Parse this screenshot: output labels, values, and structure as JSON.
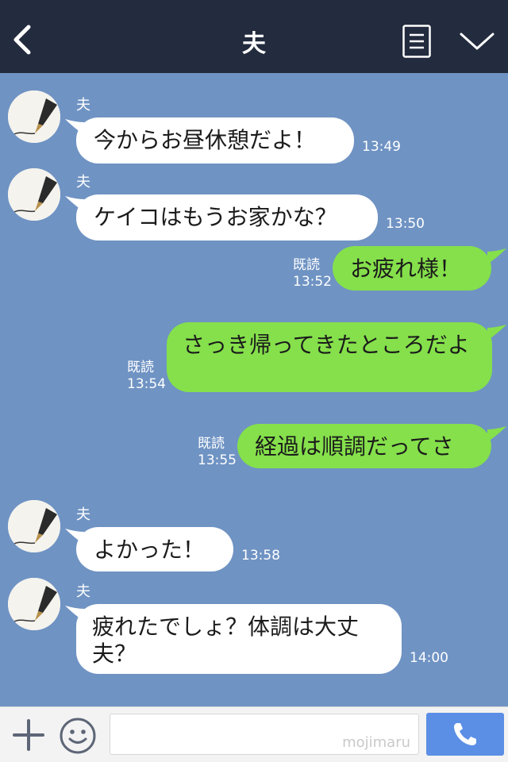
{
  "header": {
    "title": "夫"
  },
  "messages": [
    {
      "sender": "夫",
      "text": "今からお昼休憩だよ！",
      "time": "13:49"
    },
    {
      "sender": "夫",
      "text": "ケイコはもうお家かな？",
      "time": "13:50"
    },
    {
      "read": "既読",
      "text": "お疲れ様！",
      "time": "13:52"
    },
    {
      "read": "既読",
      "text": "さっき帰ってきたところだよ",
      "time": "13:54"
    },
    {
      "read": "既読",
      "text": "経過は順調だってさ",
      "time": "13:55"
    },
    {
      "sender": "夫",
      "text": "よかった！",
      "time": "13:58"
    },
    {
      "sender": "夫",
      "text": "疲れたでしょ？体調は大丈夫？",
      "time": "14:00"
    }
  ],
  "footer": {
    "watermark": "mojimaru"
  },
  "icons": {
    "back": "chevron-left-icon",
    "menu": "list-icon",
    "collapse": "chevron-down-icon",
    "plus": "plus-icon",
    "emoji": "emoji-icon",
    "call": "phone-icon"
  },
  "colors": {
    "header_bg": "#232b3e",
    "chat_bg": "#6f93c3",
    "incoming_bubble": "#ffffff",
    "outgoing_bubble": "#85e04b",
    "call_button": "#5b8fe6"
  }
}
